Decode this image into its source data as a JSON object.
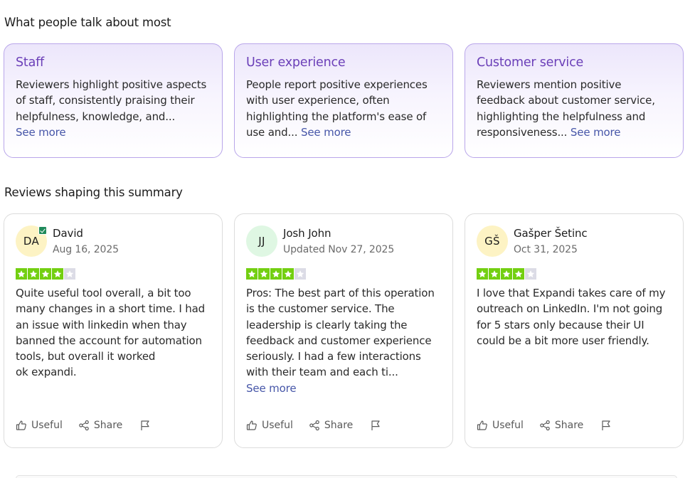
{
  "sections": {
    "topics_title": "What people talk about most",
    "reviews_title": "Reviews shaping this summary"
  },
  "topics": [
    {
      "title": "Staff",
      "text": "Reviewers highlight positive aspects of staff, consistently praising their helpfulness, knowledge, and...",
      "see_more": "See more"
    },
    {
      "title": "User experience",
      "text": "People report positive experiences with user experience, often highlighting the platform's ease of use and...",
      "see_more": "See more"
    },
    {
      "title": "Customer service",
      "text": "Reviewers mention positive feedback about customer service, highlighting the helpfulness and responsiveness...",
      "see_more": "See more"
    }
  ],
  "reviews": [
    {
      "initials": "DA",
      "avatar_color": "#fdf3c4",
      "verified": true,
      "name": "David",
      "date": "Aug 16, 2025",
      "rating": 4,
      "text_lines": [
        "Quite useful tool overall, a bit too",
        "many changes in a short time. I had",
        "an issue with linkedin when thay",
        "banned the account for automation",
        "tools, but overall it worked",
        "ok expandi."
      ],
      "see_more": ""
    },
    {
      "initials": "JJ",
      "avatar_color": "#dff7e3",
      "verified": false,
      "name": "Josh John",
      "date": "Updated Nov 27, 2025",
      "rating": 4,
      "text_lines": [
        "Pros: The best part of this operation",
        "is the customer service. The",
        "leadership is clearly taking the",
        "feedback and customer experience",
        "seriously. I had a few interactions",
        "with their team and each ti..."
      ],
      "see_more": "See more"
    },
    {
      "initials": "GŠ",
      "avatar_color": "#fdf3c4",
      "verified": false,
      "name": "Gašper Šetinc",
      "date": "Oct 31, 2025",
      "rating": 4,
      "text_lines": [
        "I love that Expandi takes care of my",
        "outreach on LinkedIn. I'm not going",
        "for 5 stars only because their UI",
        "could be a bit more user friendly."
      ],
      "see_more": ""
    }
  ],
  "actions": {
    "useful": "Useful",
    "share": "Share"
  },
  "colors": {
    "star_filled": "#73cf11",
    "star_empty": "#dcdce6",
    "accent": "#6b3fb8",
    "link": "#4656a8"
  },
  "icons": {
    "useful": "thumbs-up-icon",
    "share": "share-icon",
    "flag": "flag-icon",
    "star": "star-icon",
    "verified": "verified-check-icon"
  }
}
